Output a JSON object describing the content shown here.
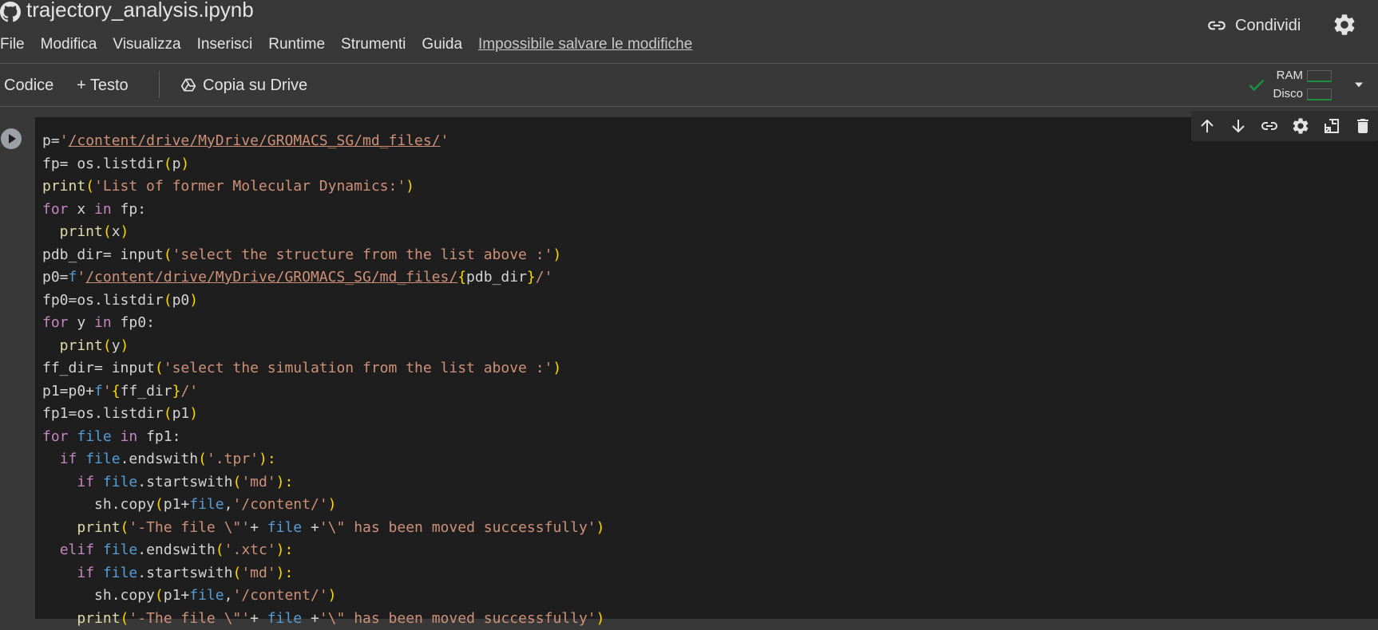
{
  "header": {
    "title": "trajectory_analysis.ipynb",
    "share_label": "Condividi"
  },
  "menu": {
    "items": [
      "File",
      "Modifica",
      "Visualizza",
      "Inserisci",
      "Runtime",
      "Strumenti",
      "Guida"
    ],
    "unsaved": "Impossibile salvare le modifiche"
  },
  "toolbar": {
    "code_label": "Codice",
    "text_label": "+ Testo",
    "drive_label": "Copia su Drive",
    "ram_label": "RAM",
    "disk_label": "Disco"
  },
  "cell": {
    "lines": [
      [
        {
          "t": "p=",
          "c": "plain"
        },
        {
          "t": "'",
          "c": "st"
        },
        {
          "t": "/content/drive/MyDrive/GROMACS_SG/md_files/",
          "c": "st ul"
        },
        {
          "t": "'",
          "c": "st"
        }
      ],
      [
        {
          "t": "fp= os.listdir",
          "c": "plain"
        },
        {
          "t": "(",
          "c": "pa"
        },
        {
          "t": "p",
          "c": "plain"
        },
        {
          "t": ")",
          "c": "pa"
        }
      ],
      [
        {
          "t": "print",
          "c": "fn"
        },
        {
          "t": "(",
          "c": "pa"
        },
        {
          "t": "'List of former Molecular Dynamics:'",
          "c": "st"
        },
        {
          "t": ")",
          "c": "pa"
        }
      ],
      [
        {
          "t": "for",
          "c": "kp"
        },
        {
          "t": " x ",
          "c": "plain"
        },
        {
          "t": "in",
          "c": "kp"
        },
        {
          "t": " fp:",
          "c": "plain"
        }
      ],
      [
        {
          "t": "  print",
          "c": "fn"
        },
        {
          "t": "(",
          "c": "pa"
        },
        {
          "t": "x",
          "c": "plain"
        },
        {
          "t": ")",
          "c": "pa"
        }
      ],
      [
        {
          "t": "pdb_dir= input",
          "c": "plain"
        },
        {
          "t": "(",
          "c": "pa"
        },
        {
          "t": "'select the structure from the list above :'",
          "c": "st"
        },
        {
          "t": ")",
          "c": "pa"
        }
      ],
      [
        {
          "t": "p0=",
          "c": "plain"
        },
        {
          "t": "f",
          "c": "kw"
        },
        {
          "t": "'",
          "c": "st"
        },
        {
          "t": "/content/drive/MyDrive/GROMACS_SG/md_files/",
          "c": "st ul"
        },
        {
          "t": "{",
          "c": "pa"
        },
        {
          "t": "pdb_dir",
          "c": "plain"
        },
        {
          "t": "}",
          "c": "pa"
        },
        {
          "t": "/'",
          "c": "st"
        }
      ],
      [
        {
          "t": "fp0=os.listdir",
          "c": "plain"
        },
        {
          "t": "(",
          "c": "pa"
        },
        {
          "t": "p0",
          "c": "plain"
        },
        {
          "t": ")",
          "c": "pa"
        }
      ],
      [
        {
          "t": "for",
          "c": "kp"
        },
        {
          "t": " y ",
          "c": "plain"
        },
        {
          "t": "in",
          "c": "kp"
        },
        {
          "t": " fp0:",
          "c": "plain"
        }
      ],
      [
        {
          "t": "  print",
          "c": "fn"
        },
        {
          "t": "(",
          "c": "pa"
        },
        {
          "t": "y",
          "c": "plain"
        },
        {
          "t": ")",
          "c": "pa"
        }
      ],
      [
        {
          "t": "ff_dir= input",
          "c": "plain"
        },
        {
          "t": "(",
          "c": "pa"
        },
        {
          "t": "'select the simulation from the list above :'",
          "c": "st"
        },
        {
          "t": ")",
          "c": "pa"
        }
      ],
      [
        {
          "t": "p1=p0+",
          "c": "plain"
        },
        {
          "t": "f",
          "c": "kw"
        },
        {
          "t": "'",
          "c": "st"
        },
        {
          "t": "{",
          "c": "pa"
        },
        {
          "t": "ff_dir",
          "c": "plain"
        },
        {
          "t": "}",
          "c": "pa"
        },
        {
          "t": "/'",
          "c": "st"
        }
      ],
      [
        {
          "t": "fp1=os.listdir",
          "c": "plain"
        },
        {
          "t": "(",
          "c": "pa"
        },
        {
          "t": "p1",
          "c": "plain"
        },
        {
          "t": ")",
          "c": "pa"
        }
      ],
      [
        {
          "t": "for",
          "c": "kp"
        },
        {
          "t": " ",
          "c": "plain"
        },
        {
          "t": "file",
          "c": "kw"
        },
        {
          "t": " ",
          "c": "plain"
        },
        {
          "t": "in",
          "c": "kp"
        },
        {
          "t": " fp1:",
          "c": "plain"
        }
      ],
      [
        {
          "t": "  ",
          "c": "plain"
        },
        {
          "t": "if",
          "c": "kp"
        },
        {
          "t": " ",
          "c": "plain"
        },
        {
          "t": "file",
          "c": "kw"
        },
        {
          "t": ".endswith",
          "c": "plain"
        },
        {
          "t": "(",
          "c": "pa"
        },
        {
          "t": "'.tpr'",
          "c": "st"
        },
        {
          "t": "):",
          "c": "pa"
        }
      ],
      [
        {
          "t": "    ",
          "c": "plain"
        },
        {
          "t": "if",
          "c": "kp"
        },
        {
          "t": " ",
          "c": "plain"
        },
        {
          "t": "file",
          "c": "kw"
        },
        {
          "t": ".startswith",
          "c": "plain"
        },
        {
          "t": "(",
          "c": "pa"
        },
        {
          "t": "'md'",
          "c": "st"
        },
        {
          "t": "):",
          "c": "pa"
        }
      ],
      [
        {
          "t": "      sh.copy",
          "c": "plain"
        },
        {
          "t": "(",
          "c": "pa"
        },
        {
          "t": "p1+",
          "c": "plain"
        },
        {
          "t": "file",
          "c": "kw"
        },
        {
          "t": ",",
          "c": "plain"
        },
        {
          "t": "'/content/'",
          "c": "st"
        },
        {
          "t": ")",
          "c": "pa"
        }
      ],
      [
        {
          "t": "    ",
          "c": "plain"
        },
        {
          "t": "print",
          "c": "fn"
        },
        {
          "t": "(",
          "c": "pa"
        },
        {
          "t": "'-The file \\\"'",
          "c": "st"
        },
        {
          "t": "+ ",
          "c": "plain"
        },
        {
          "t": "file",
          "c": "kw"
        },
        {
          "t": " +",
          "c": "plain"
        },
        {
          "t": "'\\\" has been moved successfully'",
          "c": "st"
        },
        {
          "t": ")",
          "c": "pa"
        }
      ],
      [
        {
          "t": "  ",
          "c": "plain"
        },
        {
          "t": "elif",
          "c": "kp"
        },
        {
          "t": " ",
          "c": "plain"
        },
        {
          "t": "file",
          "c": "kw"
        },
        {
          "t": ".endswith",
          "c": "plain"
        },
        {
          "t": "(",
          "c": "pa"
        },
        {
          "t": "'.xtc'",
          "c": "st"
        },
        {
          "t": "):",
          "c": "pa"
        }
      ],
      [
        {
          "t": "    ",
          "c": "plain"
        },
        {
          "t": "if",
          "c": "kp"
        },
        {
          "t": " ",
          "c": "plain"
        },
        {
          "t": "file",
          "c": "kw"
        },
        {
          "t": ".startswith",
          "c": "plain"
        },
        {
          "t": "(",
          "c": "pa"
        },
        {
          "t": "'md'",
          "c": "st"
        },
        {
          "t": "):",
          "c": "pa"
        }
      ],
      [
        {
          "t": "      sh.copy",
          "c": "plain"
        },
        {
          "t": "(",
          "c": "pa"
        },
        {
          "t": "p1+",
          "c": "plain"
        },
        {
          "t": "file",
          "c": "kw"
        },
        {
          "t": ",",
          "c": "plain"
        },
        {
          "t": "'/content/'",
          "c": "st"
        },
        {
          "t": ")",
          "c": "pa"
        }
      ],
      [
        {
          "t": "    ",
          "c": "plain"
        },
        {
          "t": "print",
          "c": "fn"
        },
        {
          "t": "(",
          "c": "pa"
        },
        {
          "t": "'-The file \\\"'",
          "c": "st"
        },
        {
          "t": "+ ",
          "c": "plain"
        },
        {
          "t": "file",
          "c": "kw"
        },
        {
          "t": " +",
          "c": "plain"
        },
        {
          "t": "'\\\" has been moved successfully'",
          "c": "st"
        },
        {
          "t": ")",
          "c": "pa"
        }
      ]
    ]
  },
  "icons": {
    "github": "github-icon",
    "link": "link-icon",
    "settings": "gear-icon",
    "drive": "drive-icon",
    "check": "check-icon",
    "dropdown": "chevron-down-icon",
    "run": "run-cell-icon",
    "move_up": "arrow-up-icon",
    "move_down": "arrow-down-icon",
    "cell_link": "link-icon",
    "cell_settings": "gear-icon",
    "mirror": "mirror-cell-icon",
    "delete": "trash-icon"
  },
  "colors": {
    "keyword_flow": "#c586c0",
    "keyword": "#569cd6",
    "string": "#ce9178",
    "bracket": "#ffd700",
    "function": "#dcdcaa",
    "status_ok": "#1e8e3e"
  }
}
